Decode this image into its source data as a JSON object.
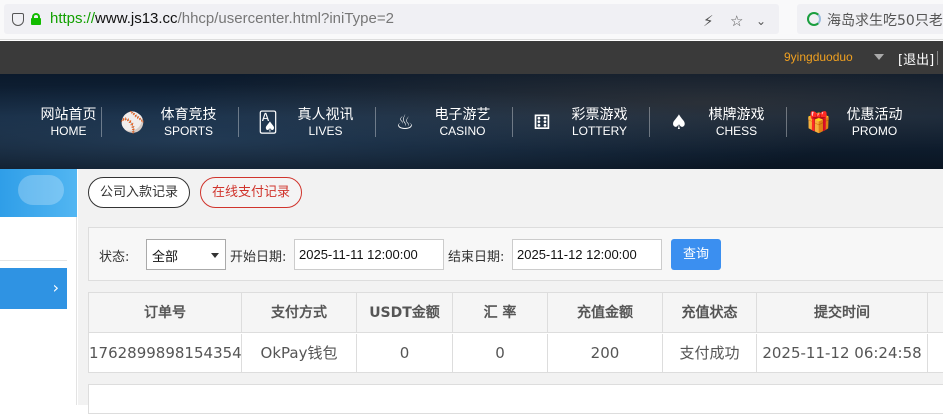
{
  "browser": {
    "url_scheme": "https://",
    "url_host": "www.js13.cc",
    "url_path": "/hhcp/usercenter.html?iniType=2",
    "other_tab_title": "海岛求生吃50只老"
  },
  "user_bar": {
    "username": "9yingduoduo",
    "logout_label": "[退出]",
    "username_color": "#f0a020"
  },
  "nav": {
    "items": [
      {
        "zh": "网站首页",
        "en": "HOME",
        "icon": "home-icon"
      },
      {
        "zh": "体育竞技",
        "en": "SPORTS",
        "icon": "ball-icon"
      },
      {
        "zh": "真人视讯",
        "en": "LIVES",
        "icon": "cards-icon"
      },
      {
        "zh": "电子游艺",
        "en": "CASINO",
        "icon": "slot-icon"
      },
      {
        "zh": "彩票游戏",
        "en": "LOTTERY",
        "icon": "dice-icon"
      },
      {
        "zh": "棋牌游戏",
        "en": "CHESS",
        "icon": "spade-icon"
      },
      {
        "zh": "优惠活动",
        "en": "PROMO",
        "icon": "gift-icon"
      }
    ]
  },
  "tabs": {
    "deposit_records": "公司入款记录",
    "online_payment_records": "在线支付记录",
    "active_color": "#d0342c"
  },
  "filter": {
    "status_label": "状态:",
    "status_value": "全部",
    "start_label": "开始日期:",
    "start_value": "2025-11-11 12:00:00",
    "end_label": "结束日期:",
    "end_value": "2025-11-12 12:00:00",
    "query_label": "查询",
    "query_color": "#3b8ff0"
  },
  "table": {
    "headers": [
      "订单号",
      "支付方式",
      "USDT金额",
      "汇 率",
      "充值金额",
      "充值状态",
      "提交时间"
    ],
    "rows": [
      [
        "1762899898154354",
        "OkPay钱包",
        "0",
        "0",
        "200",
        "支付成功",
        "2025-11-12 06:24:58"
      ]
    ]
  }
}
